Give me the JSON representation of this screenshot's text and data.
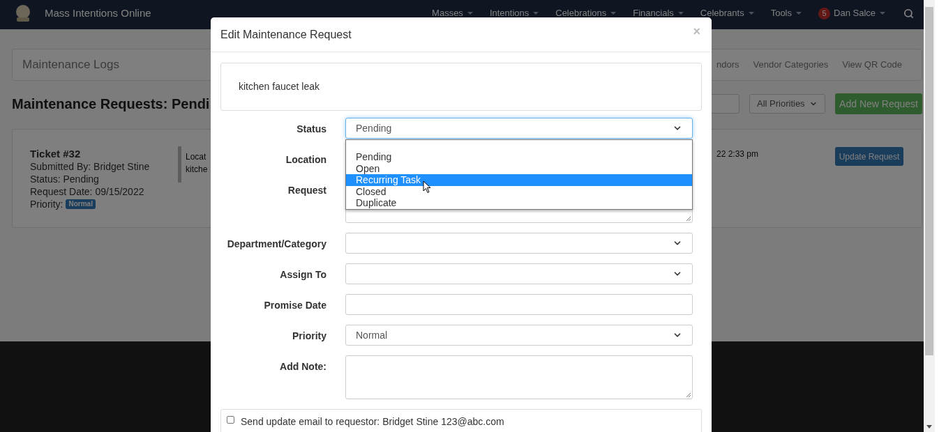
{
  "navbar": {
    "brand": "Mass Intentions Online",
    "menus": [
      "Masses",
      "Intentions",
      "Celebrations",
      "Financials",
      "Celebrants",
      "Tools"
    ],
    "user": {
      "badge": "5",
      "name": "Dan Salce"
    }
  },
  "background": {
    "logs_panel": {
      "title": "Maintenance Logs",
      "links": [
        "ndors",
        "Vendor Categories",
        "View QR Code"
      ]
    },
    "heading": "Maintenance Requests: Pendi",
    "priority_filter": "All Priorities",
    "add_button": "Add New Request",
    "ticket": {
      "title": "Ticket #32",
      "lines": [
        "Submitted By: Bridget Stine",
        "Status: Pending",
        "Request Date: 09/15/2022"
      ],
      "priority_label": "Priority:",
      "priority_badge": "Normal",
      "location_lines": [
        "Locat",
        "kitche"
      ],
      "date_fragment": "22 2:33 pm",
      "update_button": "Update Request"
    }
  },
  "modal": {
    "title": "Edit Maintenance Request",
    "close": "×",
    "description": "kitchen faucet leak",
    "fields": [
      {
        "label": "Status",
        "kind": "select",
        "value": "Pending",
        "focused": true
      },
      {
        "label": "Location",
        "kind": "covered"
      },
      {
        "label": "Request",
        "kind": "textarea",
        "focused": false
      },
      {
        "label": "Department/Category",
        "kind": "select",
        "focused": false
      },
      {
        "label": "Assign To",
        "kind": "select",
        "focused": false
      },
      {
        "label": "Promise Date",
        "kind": "input",
        "focused": false
      },
      {
        "label": "Priority",
        "kind": "select",
        "value": "Normal",
        "focused": false
      },
      {
        "label": "Add Note:",
        "kind": "textarea",
        "focused": false
      }
    ],
    "status_options": [
      {
        "label": "Pending",
        "selected": false
      },
      {
        "label": "Open",
        "selected": false
      },
      {
        "label": "Recurring Task",
        "selected": true
      },
      {
        "label": "Closed",
        "selected": false
      },
      {
        "label": "Duplicate",
        "selected": false
      }
    ],
    "email_checkbox": {
      "label": "Send update email to requestor: Bridget Stine 123@abc.com",
      "checked": false
    }
  }
}
